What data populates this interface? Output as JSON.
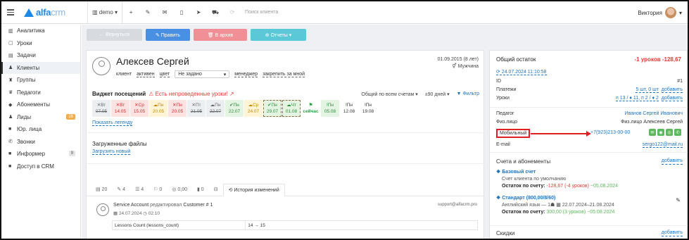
{
  "topbar": {
    "logo_main": "alfa",
    "logo_sub": "crm",
    "branch": "demo",
    "search_placeholder": "Поиск клиента",
    "user_name": "Виктория"
  },
  "sidebar": {
    "items": [
      {
        "icon": "chart-icon",
        "glyph": "▥",
        "label": "Аналитика"
      },
      {
        "icon": "calendar-icon",
        "glyph": "▢",
        "label": "Уроки"
      },
      {
        "icon": "tasks-icon",
        "glyph": "▤",
        "label": "Задачи"
      },
      {
        "icon": "user-icon",
        "glyph": "♟",
        "label": "Клиенты"
      },
      {
        "icon": "group-icon",
        "glyph": "♜",
        "label": "Группы"
      },
      {
        "icon": "teacher-icon",
        "glyph": "♛",
        "label": "Педагоги"
      },
      {
        "icon": "tag-icon",
        "glyph": "◆",
        "label": "Абонементы"
      },
      {
        "icon": "leads-icon",
        "glyph": "♟",
        "label": "Лиды",
        "badge": "28"
      },
      {
        "icon": "briefcase-icon",
        "glyph": "■",
        "label": "Юр. лица"
      },
      {
        "icon": "phone-icon",
        "glyph": "✆",
        "label": "Звонки"
      },
      {
        "icon": "info-icon",
        "glyph": "■",
        "label": "Информер",
        "badge": "9"
      },
      {
        "icon": "lock-icon",
        "glyph": "■",
        "label": "Доступ в CRM"
      }
    ]
  },
  "actions": {
    "back": "← Вернуться",
    "edit": "✎ Править",
    "archive": "🗑 В архив",
    "reports": "⊕ Отчеты ▾"
  },
  "client": {
    "name": "Алексев Сергей",
    "meta_client": "клиент",
    "meta_active": "активен",
    "meta_color": "цвет",
    "select_value": "Не задано",
    "manager": "менеджер",
    "assign_me": "закрепить за мной",
    "birth_date": "01.09.2015 (8 лет)",
    "gender": "⚥ Мужчина"
  },
  "visits": {
    "title": "Виджет посещений",
    "warning": "⚠ Есть непроведенные уроки! ↗",
    "scope": "Общий по всем счетам ▾",
    "period": "±90 дней ▾",
    "filter": "▼ Фильтр",
    "lessons": [
      {
        "day": "✕Вт",
        "date": "07.05",
        "style": "gray"
      },
      {
        "day": "✕Вт",
        "date": "14.05",
        "style": "red"
      },
      {
        "day": "✕Ср",
        "date": "15.05",
        "style": "red"
      },
      {
        "day": "☁Пн",
        "date": "20.05",
        "style": "yellow"
      },
      {
        "day": "✕Пн",
        "date": "20.05",
        "style": "red"
      },
      {
        "day": "✕Пт",
        "date": "21.05",
        "style": "gray"
      },
      {
        "day": "☁Пн",
        "date": "22.07",
        "style": "gray"
      },
      {
        "day": "✔Пн",
        "date": "22.07",
        "style": "green"
      },
      {
        "day": "☁Ср",
        "date": "24.07",
        "style": "yellow"
      },
      {
        "day": "✔Пн",
        "date": "29.07",
        "style": "green-dash"
      },
      {
        "day": "☁Чт",
        "date": "01.08",
        "style": "green-dash"
      },
      {
        "day": "⚑",
        "date": "сейчас",
        "style": "flag"
      },
      {
        "day": "!Пн",
        "date": "05.08",
        "style": "green"
      },
      {
        "day": "!Пн",
        "date": "12.08",
        "style": "plain"
      },
      {
        "day": "!Пн",
        "date": "19.08",
        "style": "plain"
      }
    ],
    "legend_link": "Показать легенду"
  },
  "files": {
    "title": "Загруженные файлы",
    "upload": "Загрузить новый"
  },
  "tabs": [
    {
      "label": "▤ 20"
    },
    {
      "label": "✎ 4"
    },
    {
      "label": "☰ 4"
    },
    {
      "label": "⚐ 0"
    },
    {
      "label": "◎ 0,00"
    },
    {
      "label": "▮ 0"
    },
    {
      "label": "⊟"
    },
    {
      "label": "⟲ История изменений",
      "active": true
    }
  ],
  "log": {
    "author": "Service Account",
    "action": "редактировал",
    "target": "Customer # 1",
    "date": "▦ 24.07.2024 ◷ 02:10",
    "email": "support@alfacrm.pro",
    "field": "Lessons Count (lessons_count)",
    "change": "14 → 15"
  },
  "summary": {
    "title": "Общий остаток",
    "balance": "-1 уроков   -128,67",
    "date": "⟳ 24.07.2024 11:10:58",
    "rows": [
      {
        "label": "ID",
        "value": "#1"
      },
      {
        "label": "Платежи",
        "value": "5 шт, 0 шт",
        "action": "добавить"
      },
      {
        "label": "Уроки",
        "value": "п 13 / ♦ 11, п 2 / ♦ 2",
        "action": "добавить"
      }
    ],
    "teacher_label": "Педагог",
    "teacher": "Иванов Сергей Иванович",
    "person_label": "Физ.лицо",
    "person": "Физ.лицо Алексеев Сергей",
    "mobile_label": "Мобильный",
    "mobile": "+7(923)213-00-00",
    "email_label": "E-mail",
    "email": "sergo122@mail.ru"
  },
  "accounts": {
    "title": "Счета и абонементы",
    "add": "добавить",
    "base_title": "Базовый счет",
    "base_desc": "Счет клиента по умолчанию",
    "base_balance_label": "Остаток по счету:",
    "base_balance": "-128,67 (-4 уроков)",
    "base_date": "~05.08.2024",
    "std_title": "Стандарт (800,00/8/60)",
    "std_desc": "Английский язык — 1☗  ▦ 22.07.2024–21.08.2024",
    "std_balance_label": "Остаток по счету:",
    "std_balance": "300,00 (3 уроков)",
    "std_date": "~05.08.2024",
    "discounts": "Скидки",
    "discounts_add": "добавить"
  }
}
